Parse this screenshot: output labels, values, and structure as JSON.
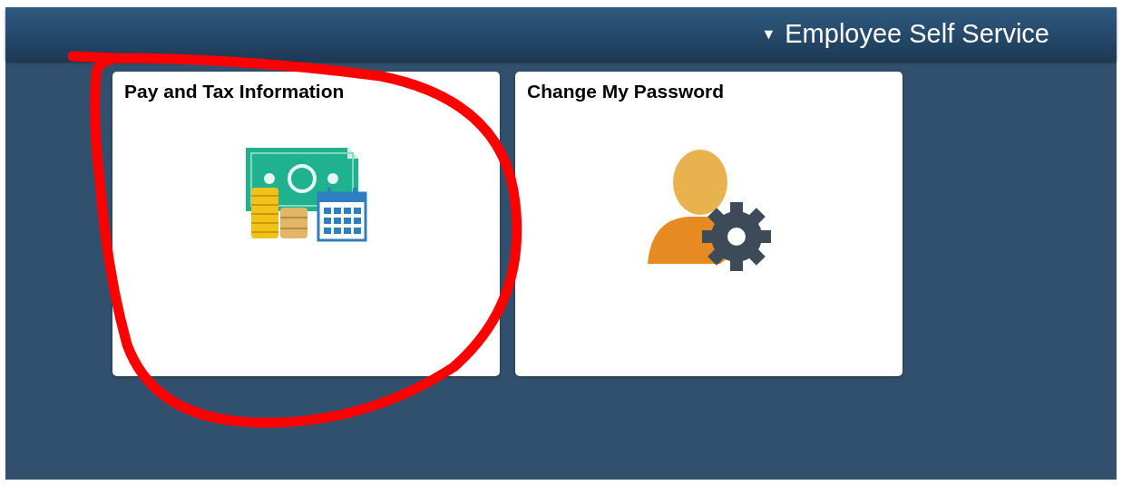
{
  "header": {
    "menu_indicator": "▼",
    "title": "Employee Self Service"
  },
  "tiles": [
    {
      "title": "Pay and Tax Information",
      "kind": "pay"
    },
    {
      "title": "Change My Password",
      "kind": "password"
    }
  ],
  "annotations": [
    {
      "kind": "circle",
      "color": "#ff0000"
    }
  ]
}
